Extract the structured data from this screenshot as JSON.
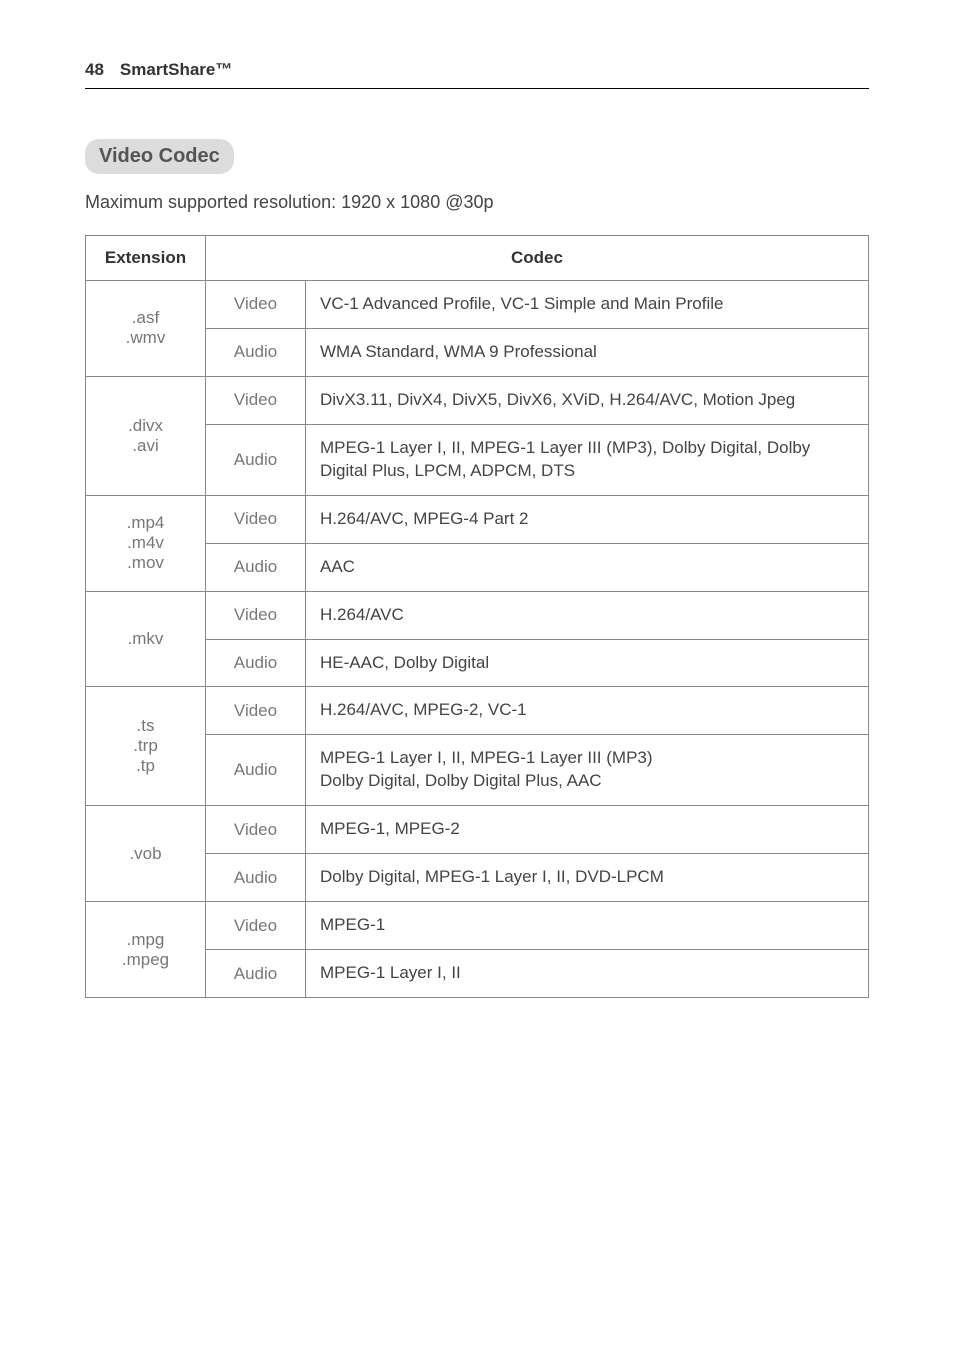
{
  "header": {
    "page_number": "48",
    "section": "SmartShare™"
  },
  "title": "Video Codec",
  "subtitle": "Maximum supported resolution: 1920 x 1080 @30p",
  "table": {
    "headers": {
      "extension": "Extension",
      "codec": "Codec"
    },
    "rows": [
      {
        "ext": ".asf\n.wmv",
        "types": [
          {
            "type": "Video",
            "codec": "VC-1 Advanced Profile, VC-1 Simple and Main Profile"
          },
          {
            "type": "Audio",
            "codec": "WMA Standard, WMA 9 Professional"
          }
        ]
      },
      {
        "ext": ".divx\n.avi",
        "types": [
          {
            "type": "Video",
            "codec": "DivX3.11, DivX4, DivX5, DivX6, XViD, H.264/AVC, Motion Jpeg"
          },
          {
            "type": "Audio",
            "codec": "MPEG-1 Layer I, II, MPEG-1 Layer III (MP3), Dolby Digital, Dolby Digital Plus, LPCM, ADPCM, DTS"
          }
        ]
      },
      {
        "ext": ".mp4\n.m4v\n.mov",
        "types": [
          {
            "type": "Video",
            "codec": "H.264/AVC, MPEG-4 Part 2"
          },
          {
            "type": "Audio",
            "codec": "AAC"
          }
        ]
      },
      {
        "ext": ".mkv",
        "types": [
          {
            "type": "Video",
            "codec": "H.264/AVC"
          },
          {
            "type": "Audio",
            "codec": "HE-AAC, Dolby Digital"
          }
        ]
      },
      {
        "ext": ".ts\n.trp\n.tp",
        "types": [
          {
            "type": "Video",
            "codec": "H.264/AVC, MPEG-2, VC-1"
          },
          {
            "type": "Audio",
            "codec": "MPEG-1 Layer I, II, MPEG-1 Layer III (MP3)\nDolby Digital, Dolby Digital Plus, AAC"
          }
        ]
      },
      {
        "ext": ".vob",
        "types": [
          {
            "type": "Video",
            "codec": "MPEG-1, MPEG-2"
          },
          {
            "type": "Audio",
            "codec": "Dolby Digital, MPEG-1 Layer I, II, DVD-LPCM"
          }
        ]
      },
      {
        "ext": ".mpg\n.mpeg",
        "types": [
          {
            "type": "Video",
            "codec": "MPEG-1"
          },
          {
            "type": "Audio",
            "codec": "MPEG-1 Layer I, II"
          }
        ]
      }
    ]
  }
}
